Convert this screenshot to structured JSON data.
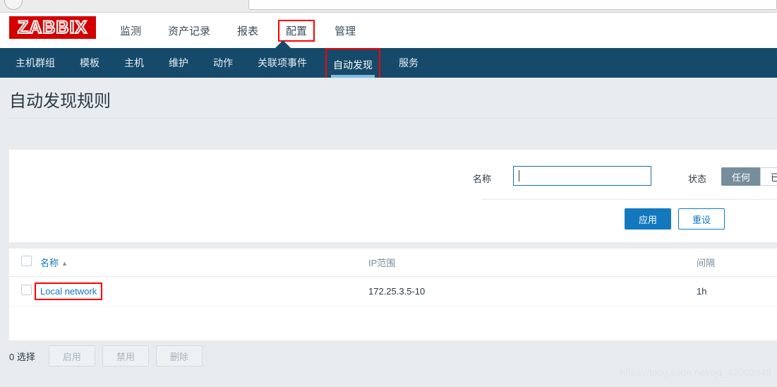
{
  "browser": {
    "back_icon": "back-arrow-icon",
    "urlbar_value": ""
  },
  "header": {
    "logo_text": "ZABBIX",
    "logo_bg": "#d40000",
    "nav_items": [
      {
        "label": "监测",
        "active": false,
        "annotated": false
      },
      {
        "label": "资产记录",
        "active": false,
        "annotated": false
      },
      {
        "label": "报表",
        "active": false,
        "annotated": false
      },
      {
        "label": "配置",
        "active": true,
        "annotated": true
      },
      {
        "label": "管理",
        "active": false,
        "annotated": false
      }
    ]
  },
  "subnav": {
    "bg": "#164a6b",
    "underline_color": "#82bbe0",
    "items": [
      {
        "label": "主机群组",
        "active": false,
        "annotated": false
      },
      {
        "label": "模板",
        "active": false,
        "annotated": false
      },
      {
        "label": "主机",
        "active": false,
        "annotated": false
      },
      {
        "label": "维护",
        "active": false,
        "annotated": false
      },
      {
        "label": "动作",
        "active": false,
        "annotated": false
      },
      {
        "label": "关联项事件",
        "active": false,
        "annotated": false
      },
      {
        "label": "自动发现",
        "active": true,
        "annotated": true
      },
      {
        "label": "服务",
        "active": false,
        "annotated": false
      }
    ]
  },
  "page": {
    "title": "自动发现规则",
    "background": "#e9ecef"
  },
  "filter": {
    "name_label": "名称",
    "name_value": "",
    "name_placeholder": "",
    "status_label": "状态",
    "status_options": [
      {
        "label": "任何",
        "selected": true
      },
      {
        "label": "已",
        "selected": false
      }
    ],
    "apply_label": "应用",
    "reset_label": "重设",
    "accent_color": "#1279bf"
  },
  "table": {
    "columns": [
      {
        "label": "名称",
        "sortable": true,
        "sort_dir": "▲"
      },
      {
        "label": "IP范围",
        "sortable": false,
        "sort_dir": ""
      },
      {
        "label": "间隔",
        "sortable": false,
        "sort_dir": ""
      }
    ],
    "rows": [
      {
        "checked": false,
        "name": "Local network",
        "ip_range": "172.25.3.5-10",
        "interval": "1h",
        "annotated": true
      }
    ]
  },
  "action_bar": {
    "selected_text": "0 选择",
    "buttons": [
      {
        "label": "启用",
        "disabled": true
      },
      {
        "label": "禁用",
        "disabled": true
      },
      {
        "label": "删除",
        "disabled": true
      }
    ]
  },
  "watermark": {
    "text": "https://blog.csdn.net/qq_42003848"
  }
}
